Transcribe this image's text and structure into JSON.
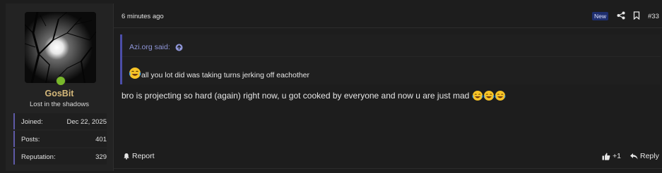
{
  "user": {
    "name": "GosBit",
    "title": "Lost in the shadows",
    "stats": [
      {
        "label": "Joined:",
        "value": "Dec 22, 2025"
      },
      {
        "label": "Posts:",
        "value": "401"
      },
      {
        "label": "Reputation:",
        "value": "329"
      }
    ],
    "online_color": "#79b82b"
  },
  "post": {
    "time": "6 minutes ago",
    "badge": "New",
    "number": "#33",
    "quote": {
      "author_line": "Azi.org said:",
      "text": "all you lot did was taking turns jerking off eachother",
      "emoji": "laughing-crying-emoji"
    },
    "message": "bro is projecting so hard (again) right now, u got cooked by everyone and now u are just mad",
    "message_emojis": [
      "laughing-crying-emoji",
      "laughing-crying-emoji",
      "laughing-crying-emoji"
    ]
  },
  "actions": {
    "report": "Report",
    "like": "+1",
    "reply": "Reply"
  },
  "colors": {
    "accent": "#4c4ea9",
    "username": "#d5b87a",
    "quote_link": "#8f96d8",
    "badge_bg": "#1e2e6e"
  }
}
